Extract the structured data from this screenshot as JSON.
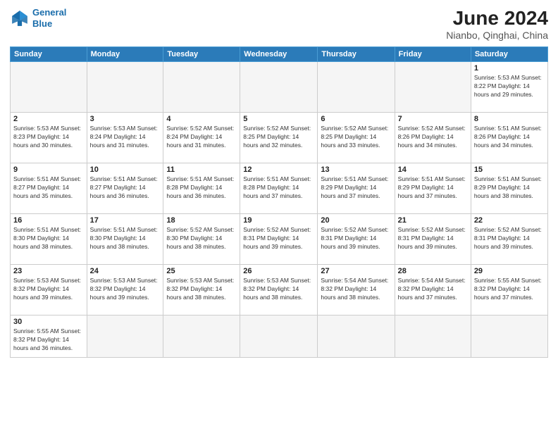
{
  "header": {
    "logo_line1": "General",
    "logo_line2": "Blue",
    "title": "June 2024",
    "location": "Nianbo, Qinghai, China"
  },
  "weekdays": [
    "Sunday",
    "Monday",
    "Tuesday",
    "Wednesday",
    "Thursday",
    "Friday",
    "Saturday"
  ],
  "weeks": [
    {
      "days": [
        {
          "num": "",
          "info": ""
        },
        {
          "num": "",
          "info": ""
        },
        {
          "num": "",
          "info": ""
        },
        {
          "num": "",
          "info": ""
        },
        {
          "num": "",
          "info": ""
        },
        {
          "num": "",
          "info": ""
        },
        {
          "num": "1",
          "info": "Sunrise: 5:53 AM\nSunset: 8:22 PM\nDaylight: 14 hours and 29 minutes."
        }
      ]
    },
    {
      "days": [
        {
          "num": "2",
          "info": "Sunrise: 5:53 AM\nSunset: 8:23 PM\nDaylight: 14 hours and 30 minutes."
        },
        {
          "num": "3",
          "info": "Sunrise: 5:53 AM\nSunset: 8:24 PM\nDaylight: 14 hours and 31 minutes."
        },
        {
          "num": "4",
          "info": "Sunrise: 5:52 AM\nSunset: 8:24 PM\nDaylight: 14 hours and 31 minutes."
        },
        {
          "num": "5",
          "info": "Sunrise: 5:52 AM\nSunset: 8:25 PM\nDaylight: 14 hours and 32 minutes."
        },
        {
          "num": "6",
          "info": "Sunrise: 5:52 AM\nSunset: 8:25 PM\nDaylight: 14 hours and 33 minutes."
        },
        {
          "num": "7",
          "info": "Sunrise: 5:52 AM\nSunset: 8:26 PM\nDaylight: 14 hours and 34 minutes."
        },
        {
          "num": "8",
          "info": "Sunrise: 5:51 AM\nSunset: 8:26 PM\nDaylight: 14 hours and 34 minutes."
        }
      ]
    },
    {
      "days": [
        {
          "num": "9",
          "info": "Sunrise: 5:51 AM\nSunset: 8:27 PM\nDaylight: 14 hours and 35 minutes."
        },
        {
          "num": "10",
          "info": "Sunrise: 5:51 AM\nSunset: 8:27 PM\nDaylight: 14 hours and 36 minutes."
        },
        {
          "num": "11",
          "info": "Sunrise: 5:51 AM\nSunset: 8:28 PM\nDaylight: 14 hours and 36 minutes."
        },
        {
          "num": "12",
          "info": "Sunrise: 5:51 AM\nSunset: 8:28 PM\nDaylight: 14 hours and 37 minutes."
        },
        {
          "num": "13",
          "info": "Sunrise: 5:51 AM\nSunset: 8:29 PM\nDaylight: 14 hours and 37 minutes."
        },
        {
          "num": "14",
          "info": "Sunrise: 5:51 AM\nSunset: 8:29 PM\nDaylight: 14 hours and 37 minutes."
        },
        {
          "num": "15",
          "info": "Sunrise: 5:51 AM\nSunset: 8:29 PM\nDaylight: 14 hours and 38 minutes."
        }
      ]
    },
    {
      "days": [
        {
          "num": "16",
          "info": "Sunrise: 5:51 AM\nSunset: 8:30 PM\nDaylight: 14 hours and 38 minutes."
        },
        {
          "num": "17",
          "info": "Sunrise: 5:51 AM\nSunset: 8:30 PM\nDaylight: 14 hours and 38 minutes."
        },
        {
          "num": "18",
          "info": "Sunrise: 5:52 AM\nSunset: 8:30 PM\nDaylight: 14 hours and 38 minutes."
        },
        {
          "num": "19",
          "info": "Sunrise: 5:52 AM\nSunset: 8:31 PM\nDaylight: 14 hours and 39 minutes."
        },
        {
          "num": "20",
          "info": "Sunrise: 5:52 AM\nSunset: 8:31 PM\nDaylight: 14 hours and 39 minutes."
        },
        {
          "num": "21",
          "info": "Sunrise: 5:52 AM\nSunset: 8:31 PM\nDaylight: 14 hours and 39 minutes."
        },
        {
          "num": "22",
          "info": "Sunrise: 5:52 AM\nSunset: 8:31 PM\nDaylight: 14 hours and 39 minutes."
        }
      ]
    },
    {
      "days": [
        {
          "num": "23",
          "info": "Sunrise: 5:53 AM\nSunset: 8:32 PM\nDaylight: 14 hours and 39 minutes."
        },
        {
          "num": "24",
          "info": "Sunrise: 5:53 AM\nSunset: 8:32 PM\nDaylight: 14 hours and 39 minutes."
        },
        {
          "num": "25",
          "info": "Sunrise: 5:53 AM\nSunset: 8:32 PM\nDaylight: 14 hours and 38 minutes."
        },
        {
          "num": "26",
          "info": "Sunrise: 5:53 AM\nSunset: 8:32 PM\nDaylight: 14 hours and 38 minutes."
        },
        {
          "num": "27",
          "info": "Sunrise: 5:54 AM\nSunset: 8:32 PM\nDaylight: 14 hours and 38 minutes."
        },
        {
          "num": "28",
          "info": "Sunrise: 5:54 AM\nSunset: 8:32 PM\nDaylight: 14 hours and 37 minutes."
        },
        {
          "num": "29",
          "info": "Sunrise: 5:55 AM\nSunset: 8:32 PM\nDaylight: 14 hours and 37 minutes."
        }
      ]
    },
    {
      "days": [
        {
          "num": "30",
          "info": "Sunrise: 5:55 AM\nSunset: 8:32 PM\nDaylight: 14 hours and 36 minutes."
        },
        {
          "num": "",
          "info": ""
        },
        {
          "num": "",
          "info": ""
        },
        {
          "num": "",
          "info": ""
        },
        {
          "num": "",
          "info": ""
        },
        {
          "num": "",
          "info": ""
        },
        {
          "num": "",
          "info": ""
        }
      ]
    }
  ]
}
